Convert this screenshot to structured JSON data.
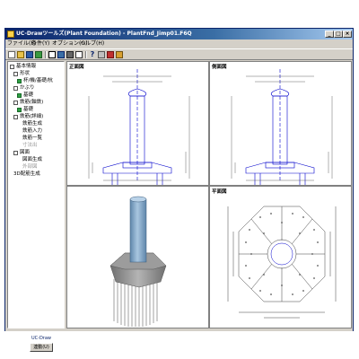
{
  "window": {
    "title": "UC-Drawツールズ(Plant Foundation) - PlantFnd_Jimp01.F6Q"
  },
  "title_buttons": {
    "min": "_",
    "max": "□",
    "close": "×"
  },
  "menu": {
    "file": "ファイル(F)",
    "conditions": "条件(Y)",
    "options": "オプション(O)",
    "help": "ヘルプ(H)"
  },
  "toolbar": {
    "icons": [
      "new-icon",
      "open-icon",
      "save-icon",
      "save-as-icon",
      "window-icon",
      "view-icon",
      "draw-icon",
      "print-icon",
      "help-icon",
      "crop-icon",
      "export-icon",
      "lock-icon"
    ]
  },
  "tree": {
    "items": [
      {
        "label": "基本情報"
      },
      {
        "label": "形状"
      },
      {
        "label": "杯/機/基礎/杭"
      },
      {
        "label": "かぶり"
      },
      {
        "label": "基礎"
      },
      {
        "label": "鉄筋(軸鉄)"
      },
      {
        "label": "基礎"
      },
      {
        "label": "鉄筋(詳細)"
      },
      {
        "label": "鉄筋生成"
      },
      {
        "label": "鉄筋入力"
      },
      {
        "label": "鉄筋一覧"
      },
      {
        "label": "寸法出"
      },
      {
        "label": "図面"
      },
      {
        "label": "図面生成"
      },
      {
        "label": "外部図"
      },
      {
        "label": "3D配筋生成"
      }
    ]
  },
  "bottom": {
    "label": "UC-Draw",
    "button": "連動(U)"
  },
  "views": {
    "front": "正面図",
    "side": "側面図",
    "plan": "平面図"
  },
  "colors": {
    "column": "#8eb0cc",
    "footing": "#9a9a9a",
    "blueprint": "#0000cc",
    "dim": "#404040"
  }
}
